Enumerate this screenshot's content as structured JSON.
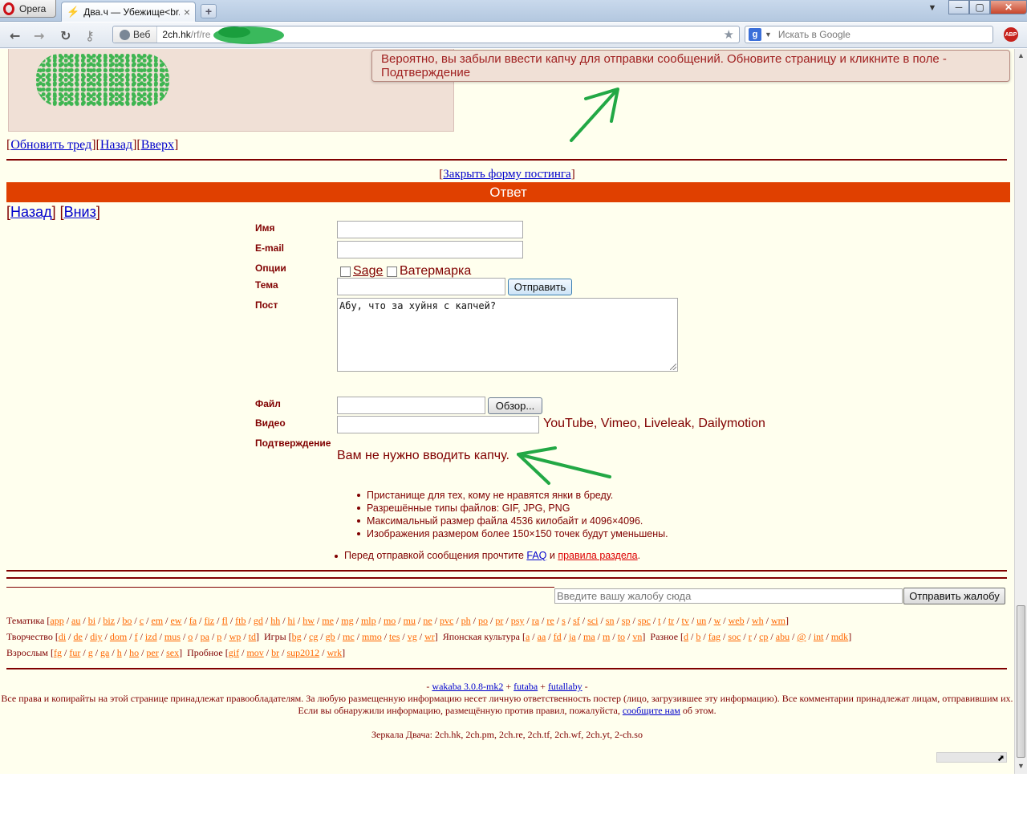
{
  "browser": {
    "menu_label": "Opera",
    "tab_title": "Два.ч — Убежище<br...",
    "tab_close": "×",
    "newtab": "+",
    "window_controls": {
      "minimize": "─",
      "restore": "▢",
      "close": "✕"
    },
    "address": {
      "mode_label": "Веб",
      "url_host": "2ch.hk",
      "url_path": "/rf/re"
    },
    "search_placeholder": "Искать в Google",
    "abp_label": "ABP"
  },
  "page": {
    "captcha_warning": "Вероятно, вы забыли ввести капчу для отправки сообщений. Обновите страницу и кликните в поле - Подтверждение",
    "thread_nav": {
      "update": "Обновить тред",
      "back": "Назад",
      "up": "Вверх"
    },
    "close_form": "Закрыть форму постинга",
    "reply_header": "Ответ",
    "nav": {
      "back": "Назад",
      "down": "Вниз"
    },
    "form": {
      "name_label": "Имя",
      "email_label": "E-mail",
      "options_label": "Опции",
      "sage_label": "Sage",
      "watermark_label": "Ватермарка",
      "subject_label": "Тема",
      "submit_label": "Отправить",
      "post_label": "Пост",
      "post_text": "Абу, что за хуйня с капчей?",
      "file_label": "Файл",
      "browse_label": "Обзор...",
      "video_label": "Видео",
      "video_hint": "YouTube, Vimeo, Liveleak, Dailymotion",
      "confirm_label": "Подтверждение",
      "captcha_message": "Вам не нужно вводить капчу."
    },
    "rules": [
      "Пристанище для тех, кому не нравятся янки в бреду.",
      "Разрешённые типы файлов: GIF, JPG, PNG",
      "Максимальный размер файла 4536 килобайт и 4096×4096.",
      "Изображения размером более 150×150 точек будут уменьшены."
    ],
    "faq_line": {
      "before": "Перед отправкой сообщения прочтите ",
      "faq": "FAQ",
      "middle": " и ",
      "rules": "правила раздела",
      "after": "."
    },
    "complaint": {
      "placeholder": "Введите вашу жалобу сюда",
      "button": "Отправить жалобу"
    },
    "board_groups": [
      {
        "rows": [
          {
            "segments": [
              {
                "label": "Тематика",
                "boards": [
                  "app",
                  "au",
                  "bi",
                  "biz",
                  "bo",
                  "c",
                  "em",
                  "ew",
                  "fa",
                  "fiz",
                  "fl",
                  "ftb",
                  "gd",
                  "hh",
                  "hi",
                  "hw",
                  "me",
                  "mg",
                  "mlp",
                  "mo",
                  "mu",
                  "ne",
                  "pvc",
                  "ph",
                  "po",
                  "pr",
                  "psy",
                  "ra",
                  "re",
                  "s",
                  "sf",
                  "sci",
                  "sn",
                  "sp",
                  "spc",
                  "t",
                  "tr",
                  "tv",
                  "un",
                  "w",
                  "web",
                  "wh",
                  "wm"
                ]
              }
            ]
          },
          {
            "segments": [
              {
                "label": "Творчество",
                "boards": [
                  "di",
                  "de",
                  "diy",
                  "dom",
                  "f",
                  "izd",
                  "mus",
                  "o",
                  "pa",
                  "p",
                  "wp",
                  "td"
                ]
              },
              {
                "label": "Игры",
                "boards": [
                  "bg",
                  "cg",
                  "gb",
                  "mc",
                  "mmo",
                  "tes",
                  "vg",
                  "wr"
                ]
              },
              {
                "label": "Японская культура",
                "boards": [
                  "a",
                  "aa",
                  "fd",
                  "ja",
                  "ma",
                  "m",
                  "to",
                  "vn"
                ]
              },
              {
                "label": "Разное",
                "boards": [
                  "d",
                  "b",
                  "fag",
                  "soc",
                  "r",
                  "cp",
                  "abu",
                  "@",
                  "int",
                  "mdk"
                ]
              }
            ]
          },
          {
            "segments": [
              {
                "label": "Взрослым",
                "boards": [
                  "fg",
                  "fur",
                  "g",
                  "ga",
                  "h",
                  "ho",
                  "per",
                  "sex"
                ]
              },
              {
                "label": "Пробное",
                "boards": [
                  "gif",
                  "mov",
                  "br",
                  "sup2012",
                  "wrk"
                ]
              }
            ]
          }
        ]
      }
    ],
    "footer": {
      "engine_prefix": "- ",
      "wakaba": "wakaba 3.0.8-mk2",
      "plus1": " + ",
      "futaba": "futaba",
      "plus2": " + ",
      "futallaby": "futallaby",
      "engine_suffix": " -",
      "copyright": "Все права и копирайты на этой странице принадлежат правообладателям. За любую размещенную информацию несет личную ответственность постер (лицо, загрузившее эту информацию). Все комментарии принадлежат лицам, отправившим их.",
      "report_before": "Если вы обнаружили информацию, размещённую против правил, пожалуйста, ",
      "report_link": "сообщите нам",
      "report_after": " об этом.",
      "mirrors": "Зеркала Двача: 2ch.hk, 2ch.pm, 2ch.re, 2ch.tf, 2ch.wf, 2ch.yt, 2-ch.so"
    }
  },
  "colors": {
    "page_bg": "#ffffee",
    "text": "#800000",
    "accent": "#e04000",
    "link": "#0000cc",
    "board_link": "#ff6600",
    "annotation": "#22a845"
  }
}
